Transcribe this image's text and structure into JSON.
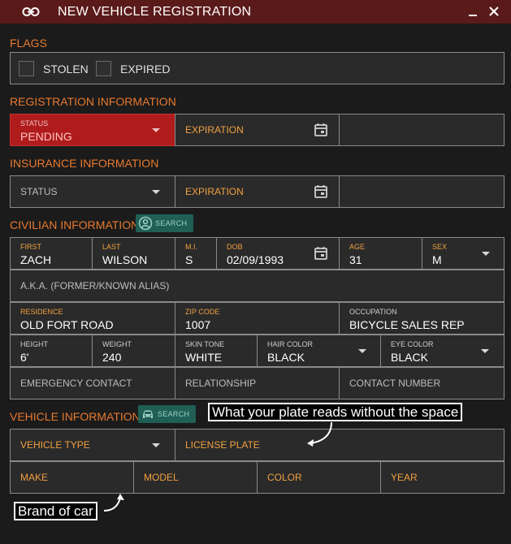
{
  "window": {
    "title": "NEW VEHICLE REGISTRATION"
  },
  "flags": {
    "title": "FLAGS",
    "stolen": "STOLEN",
    "expired": "EXPIRED"
  },
  "registration": {
    "title": "REGISTRATION INFORMATION",
    "status_label": "STATUS",
    "status_value": "PENDING",
    "expiration": "EXPIRATION"
  },
  "insurance": {
    "title": "INSURANCE INFORMATION",
    "status": "STATUS",
    "expiration": "EXPIRATION"
  },
  "civilian": {
    "title": "CIVILIAN INFORMATION",
    "search": "SEARCH",
    "first": {
      "label": "FIRST",
      "value": "ZACH"
    },
    "last": {
      "label": "LAST",
      "value": "WILSON"
    },
    "mi": {
      "label": "M.I.",
      "value": "S"
    },
    "dob": {
      "label": "DOB",
      "value": "02/09/1993"
    },
    "age": {
      "label": "AGE",
      "value": "31"
    },
    "sex": {
      "label": "SEX",
      "value": "M"
    },
    "aka": "A.K.A. (FORMER/KNOWN ALIAS)",
    "residence": {
      "label": "RESIDENCE",
      "value": "OLD FORT ROAD"
    },
    "zip": {
      "label": "ZIP CODE",
      "value": "1007"
    },
    "occupation": {
      "label": "OCCUPATION",
      "value": "BICYCLE SALES REP"
    },
    "height": {
      "label": "HEIGHT",
      "value": "6'"
    },
    "weight": {
      "label": "WEIGHT",
      "value": "240"
    },
    "skin": {
      "label": "SKIN TONE",
      "value": "WHITE"
    },
    "hair": {
      "label": "HAIR COLOR",
      "value": "BLACK"
    },
    "eye": {
      "label": "EYE COLOR",
      "value": "BLACK"
    },
    "emergency": "EMERGENCY CONTACT",
    "relationship": "RELATIONSHIP",
    "contact": "CONTACT NUMBER"
  },
  "vehicle": {
    "title": "VEHICLE INFORMATION",
    "search": "SEARCH",
    "type": "VEHICLE TYPE",
    "plate": "LICENSE PLATE",
    "make": "MAKE",
    "model": "MODEL",
    "color": "COLOR",
    "year": "YEAR"
  },
  "annotations": {
    "plate_hint": "What your plate reads without the space",
    "make_hint": "Brand of car"
  },
  "colors": {
    "accent": "#e8792e",
    "titlebar": "#5b1a1a",
    "status_red": "#b01c1c",
    "search_btn": "#1f5f55"
  }
}
